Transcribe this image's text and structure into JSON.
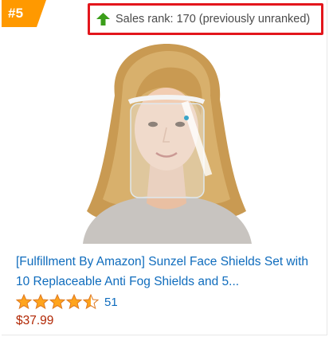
{
  "badge": {
    "rank": "#5",
    "color": "#ff9900"
  },
  "sales_rank": {
    "text": "Sales rank: 170 (previously unranked)",
    "arrow_icon": "up-arrow-icon",
    "arrow_color": "#3b9e1a",
    "highlight_color": "#e3161c"
  },
  "product": {
    "image_alt": "face-shield-product-photo",
    "title": "[Fulfillment By Amazon] Sunzel Face Shields Set with 10 Replaceable Anti Fog Shields and 5...",
    "rating_stars": 4.5,
    "rating_max": 5,
    "rating_count": "51",
    "price": "$37.99"
  },
  "colors": {
    "link": "#0f6cbd",
    "price": "#b12704",
    "star": "#ffa41c"
  }
}
